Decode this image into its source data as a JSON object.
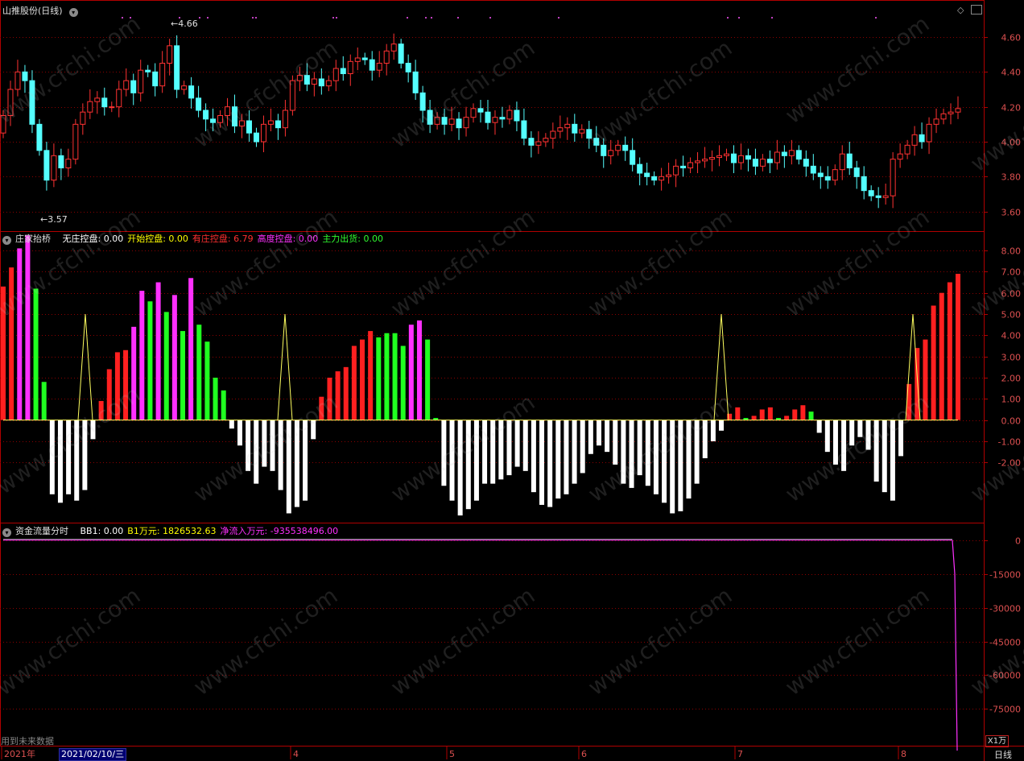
{
  "header1": {
    "title": "山推股份",
    "period": "(日线)"
  },
  "header2": {
    "name": "庄家抬桥",
    "items": [
      {
        "label": "无庄控盘:",
        "value": "0.00",
        "color": "#ffffff"
      },
      {
        "label": "开始控盘:",
        "value": "0.00",
        "color": "#ffff00"
      },
      {
        "label": "有庄控盘:",
        "value": "6.79",
        "color": "#ff3030"
      },
      {
        "label": "高度控盘:",
        "value": "0.00",
        "color": "#ff30ff"
      },
      {
        "label": "主力出货:",
        "value": "0.00",
        "color": "#30ff30"
      }
    ]
  },
  "header3": {
    "name": "资金流量分时",
    "items": [
      {
        "label": "BB1:",
        "value": "0.00",
        "color": "#ffffff"
      },
      {
        "label": "B1万元:",
        "value": "1826532.63",
        "color": "#ffff00"
      },
      {
        "label": "净流入万元:",
        "value": "-935538496.00",
        "color": "#ff30ff"
      }
    ]
  },
  "footer": {
    "note": "用到未来数据",
    "selected_date": "2021/02/10/三",
    "unit": "X1万",
    "period_tab": "日线"
  },
  "colors": {
    "up": "#ff3232",
    "down": "#54ffff",
    "grid": "#8a0000",
    "frame": "#b00000"
  },
  "watermark": "www.cfchi.com",
  "chart_data": [
    {
      "type": "candlestick",
      "title": "山推股份 (日线)",
      "ylim": [
        3.52,
        4.72
      ],
      "y_ticks": [
        "4.60",
        "4.40",
        "4.20",
        "4.00",
        "3.80",
        "3.60"
      ],
      "x_ticks": [
        "2021年",
        "4",
        "5",
        "6",
        "7",
        "8"
      ],
      "annotations": [
        {
          "text": "4.66",
          "type": "high"
        },
        {
          "text": "3.57",
          "type": "low"
        }
      ],
      "close": [
        4.15,
        4.3,
        4.4,
        4.35,
        4.1,
        3.95,
        3.78,
        3.92,
        3.85,
        3.9,
        4.1,
        4.17,
        4.23,
        4.25,
        4.2,
        4.2,
        4.3,
        4.35,
        4.28,
        4.41,
        4.4,
        4.32,
        4.45,
        4.55,
        4.3,
        4.32,
        4.25,
        4.18,
        4.13,
        4.11,
        4.15,
        4.2,
        4.09,
        4.12,
        4.05,
        4.0,
        4.1,
        4.12,
        4.08,
        4.18,
        4.35,
        4.38,
        4.33,
        4.36,
        4.32,
        4.35,
        4.42,
        4.39,
        4.46,
        4.48,
        4.47,
        4.41,
        4.45,
        4.52,
        4.56,
        4.45,
        4.4,
        4.28,
        4.18,
        4.1,
        4.14,
        4.1,
        4.13,
        4.08,
        4.14,
        4.19,
        4.17,
        4.11,
        4.14,
        4.13,
        4.18,
        4.12,
        4.02,
        3.98,
        4.0,
        4.02,
        4.06,
        4.08,
        4.1,
        4.05,
        4.07,
        4.02,
        3.98,
        3.92,
        3.95,
        3.98,
        3.95,
        3.87,
        3.82,
        3.8,
        3.78,
        3.8,
        3.81,
        3.86,
        3.85,
        3.88,
        3.89,
        3.9,
        3.91,
        3.92,
        3.93,
        3.88,
        3.92,
        3.9,
        3.86,
        3.9,
        3.88,
        3.94,
        3.92,
        3.95,
        3.9,
        3.86,
        3.82,
        3.8,
        3.78,
        3.84,
        3.93,
        3.85,
        3.8,
        3.72,
        3.69,
        3.68,
        3.69,
        3.9,
        3.93,
        3.98,
        4.04,
        4.0,
        4.1,
        4.13,
        4.16,
        4.17,
        4.19
      ],
      "up_days": "red candles = close above open, cyan candles = close below open"
    },
    {
      "type": "bar",
      "title": "庄家抬桥",
      "ylim": [
        -4.8,
        8.8
      ],
      "y_ticks": [
        "8.00",
        "7.00",
        "6.00",
        "5.00",
        "4.00",
        "3.00",
        "2.00",
        "1.00",
        "0.00",
        "-1.00",
        "-2.00"
      ],
      "series": [
        {
          "name": "有庄控盘",
          "color": "#ff3030"
        },
        {
          "name": "高度控盘",
          "color": "#ff30ff"
        },
        {
          "name": "主力出货",
          "color": "#30ff30"
        },
        {
          "name": "无庄控盘",
          "color": "#ffffff"
        },
        {
          "name": "开始控盘",
          "color": "#ffff00"
        }
      ],
      "bars": [
        [
          6.3,
          "r"
        ],
        [
          7.2,
          "r"
        ],
        [
          8.1,
          "m"
        ],
        [
          8.7,
          "m"
        ],
        [
          6.2,
          "g"
        ],
        [
          1.8,
          "g"
        ],
        [
          -3.5,
          "w"
        ],
        [
          -3.9,
          "w"
        ],
        [
          -3.5,
          "w"
        ],
        [
          -3.8,
          "w"
        ],
        [
          -3.3,
          "w"
        ],
        [
          -0.9,
          "w"
        ],
        [
          0.9,
          "r"
        ],
        [
          2.4,
          "r"
        ],
        [
          3.2,
          "r"
        ],
        [
          3.3,
          "r"
        ],
        [
          4.4,
          "m"
        ],
        [
          6.1,
          "m"
        ],
        [
          5.6,
          "g"
        ],
        [
          6.5,
          "m"
        ],
        [
          5.1,
          "g"
        ],
        [
          5.9,
          "m"
        ],
        [
          4.2,
          "g"
        ],
        [
          6.7,
          "m"
        ],
        [
          4.5,
          "g"
        ],
        [
          3.7,
          "g"
        ],
        [
          2.0,
          "g"
        ],
        [
          1.4,
          "g"
        ],
        [
          -0.4,
          "w"
        ],
        [
          -1.2,
          "w"
        ],
        [
          -2.4,
          "w"
        ],
        [
          -3.0,
          "w"
        ],
        [
          -2.2,
          "w"
        ],
        [
          -2.4,
          "w"
        ],
        [
          -3.3,
          "w"
        ],
        [
          -4.4,
          "w"
        ],
        [
          -4.1,
          "w"
        ],
        [
          -3.8,
          "w"
        ],
        [
          -0.9,
          "w"
        ],
        [
          1.1,
          "r"
        ],
        [
          2.0,
          "r"
        ],
        [
          2.3,
          "r"
        ],
        [
          2.5,
          "r"
        ],
        [
          3.5,
          "r"
        ],
        [
          3.8,
          "r"
        ],
        [
          4.2,
          "r"
        ],
        [
          3.9,
          "g"
        ],
        [
          4.1,
          "g"
        ],
        [
          4.1,
          "g"
        ],
        [
          3.5,
          "g"
        ],
        [
          4.5,
          "m"
        ],
        [
          4.7,
          "m"
        ],
        [
          3.8,
          "g"
        ],
        [
          0.1,
          "g"
        ],
        [
          -3.1,
          "w"
        ],
        [
          -3.8,
          "w"
        ],
        [
          -4.5,
          "w"
        ],
        [
          -4.2,
          "w"
        ],
        [
          -3.8,
          "w"
        ],
        [
          -3.0,
          "w"
        ],
        [
          -3.0,
          "w"
        ],
        [
          -2.8,
          "w"
        ],
        [
          -2.6,
          "w"
        ],
        [
          -2.2,
          "w"
        ],
        [
          -2.4,
          "w"
        ],
        [
          -3.4,
          "w"
        ],
        [
          -4.0,
          "w"
        ],
        [
          -4.1,
          "w"
        ],
        [
          -3.7,
          "w"
        ],
        [
          -3.5,
          "w"
        ],
        [
          -3.0,
          "w"
        ],
        [
          -2.5,
          "w"
        ],
        [
          -1.6,
          "w"
        ],
        [
          -1.2,
          "w"
        ],
        [
          -1.5,
          "w"
        ],
        [
          -2.1,
          "w"
        ],
        [
          -3.0,
          "w"
        ],
        [
          -3.2,
          "w"
        ],
        [
          -2.6,
          "w"
        ],
        [
          -3.1,
          "w"
        ],
        [
          -3.5,
          "w"
        ],
        [
          -3.9,
          "w"
        ],
        [
          -4.4,
          "w"
        ],
        [
          -4.3,
          "w"
        ],
        [
          -3.7,
          "w"
        ],
        [
          -3.0,
          "w"
        ],
        [
          -1.8,
          "w"
        ],
        [
          -1.0,
          "w"
        ],
        [
          -0.5,
          "w"
        ],
        [
          0.3,
          "r"
        ],
        [
          0.6,
          "r"
        ],
        [
          0.1,
          "g"
        ],
        [
          0.2,
          "r"
        ],
        [
          0.5,
          "r"
        ],
        [
          0.6,
          "r"
        ],
        [
          0.1,
          "g"
        ],
        [
          0.2,
          "r"
        ],
        [
          0.5,
          "r"
        ],
        [
          0.7,
          "r"
        ],
        [
          0.4,
          "g"
        ],
        [
          -0.6,
          "w"
        ],
        [
          -1.5,
          "w"
        ],
        [
          -2.1,
          "w"
        ],
        [
          -2.4,
          "w"
        ],
        [
          -1.2,
          "w"
        ],
        [
          -0.8,
          "w"
        ],
        [
          -1.4,
          "w"
        ],
        [
          -2.9,
          "w"
        ],
        [
          -3.4,
          "w"
        ],
        [
          -3.8,
          "w"
        ],
        [
          -1.7,
          "w"
        ],
        [
          1.7,
          "r"
        ],
        [
          3.4,
          "r"
        ],
        [
          3.8,
          "r"
        ],
        [
          5.4,
          "r"
        ],
        [
          6.0,
          "r"
        ],
        [
          6.5,
          "r"
        ],
        [
          6.9,
          "r"
        ]
      ],
      "peaks_of_yellow_line": [
        5.0,
        5.0,
        5.0,
        5.0
      ]
    },
    {
      "type": "line",
      "title": "资金流量分时",
      "ylim": [
        -91000,
        1000
      ],
      "y_ticks": [
        "0",
        "-15000",
        "-30000",
        "-45000",
        "-60000",
        "-75000"
      ],
      "series": [
        {
          "name": "净流入万元",
          "color": "#ff30ff",
          "description": "flat near 0, drops sharply to about -93553 on the last bar"
        }
      ]
    }
  ]
}
